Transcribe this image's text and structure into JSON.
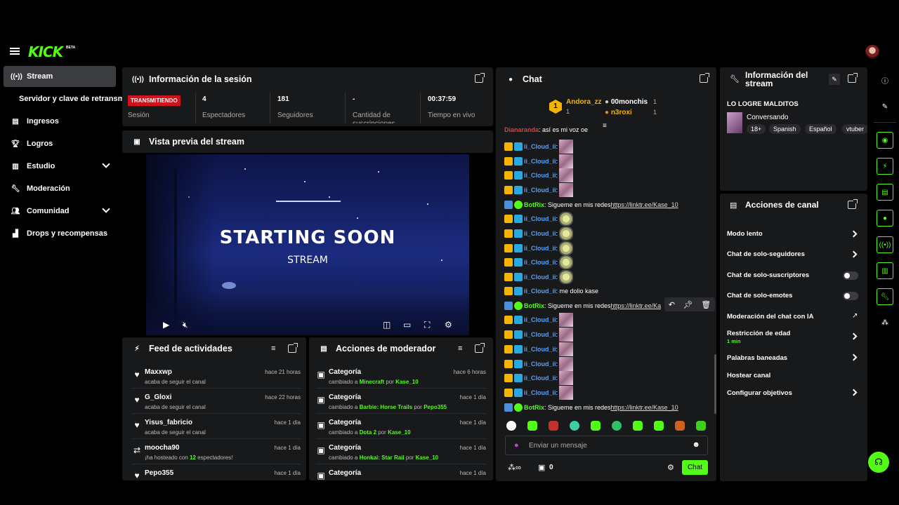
{
  "brand": {
    "logo": "KICK",
    "beta": "BETA"
  },
  "sidebar": {
    "items": [
      {
        "label": "Stream",
        "icon": "broadcast-icon"
      },
      {
        "label": "Servidor y clave de retransmisión",
        "icon": ""
      },
      {
        "label": "Ingresos",
        "icon": "chart-icon"
      },
      {
        "label": "Logros",
        "icon": "trophy-icon"
      },
      {
        "label": "Estudio",
        "icon": "layout-icon"
      },
      {
        "label": "Moderación",
        "icon": "wrench-icon"
      },
      {
        "label": "Comunidad",
        "icon": "users-icon"
      },
      {
        "label": "Drops y recompensas",
        "icon": "drops-icon"
      }
    ]
  },
  "session": {
    "title": "Información de la sesión",
    "status": "TRANSMITIENDO",
    "status_label": "Sesión",
    "stats": [
      {
        "value": "4",
        "label": "Espectadores"
      },
      {
        "value": "181",
        "label": "Seguidores"
      },
      {
        "value": "-",
        "label": "Cantidad de suscripciones"
      },
      {
        "value": "00:37:59",
        "label": "Tiempo en vivo"
      }
    ]
  },
  "preview": {
    "title": "Vista previa del stream",
    "headline": "STARTING SOON",
    "sub": "STREAM"
  },
  "feed": {
    "title": "Feed de actividades",
    "items": [
      {
        "name": "Maxxwp",
        "sub": "acaba de seguir el canal",
        "time": "hace 21 horas",
        "icon": "heart-icon"
      },
      {
        "name": "G_Gloxi",
        "sub": "acaba de seguir el canal",
        "time": "hace 22 horas",
        "icon": "heart-icon"
      },
      {
        "name": "Yisus_fabricio",
        "sub": "acaba de seguir el canal",
        "time": "hace 1 día",
        "icon": "heart-icon"
      },
      {
        "name": "moocha90",
        "sub_pre": "¡ha hosteado con ",
        "sub_num": "12",
        "sub_post": " espectadores!",
        "time": "hace 1 día",
        "icon": "host-icon"
      },
      {
        "name": "Pepo355",
        "sub": "",
        "time": "hace 1 día",
        "icon": "heart-icon"
      }
    ]
  },
  "modactions": {
    "title": "Acciones de moderador",
    "items": [
      {
        "name": "Categoría",
        "pre": "cambiado a ",
        "cat": "Minecraft",
        "by": " por ",
        "user": "Kase_10",
        "time": "hace 6 horas"
      },
      {
        "name": "Categoría",
        "pre": "cambiado a ",
        "cat": "Barbie: Horse Trails",
        "by": " por ",
        "user": "Pepo355",
        "time": "hace 1 día"
      },
      {
        "name": "Categoría",
        "pre": "cambiado a ",
        "cat": "Dota 2",
        "by": " por ",
        "user": "Kase_10",
        "time": "hace 1 día"
      },
      {
        "name": "Categoría",
        "pre": "cambiado a ",
        "cat": "Honkai: Star Rail",
        "by": " por ",
        "user": "Kase_10",
        "time": "hace 1 día"
      },
      {
        "name": "Categoría",
        "pre": "",
        "cat": "",
        "by": "",
        "user": "",
        "time": "hace 1 día"
      }
    ]
  },
  "chat": {
    "title": "Chat",
    "leaders": [
      {
        "rank": "1",
        "name": "Andora_zz",
        "count": "1"
      },
      {
        "name": "00monchis",
        "count": "1"
      },
      {
        "name": "n3roxi",
        "count": "1"
      }
    ],
    "partial": {
      "user": "Dianaranda",
      "text": ": así es mi voz oe"
    },
    "cloud_user": "ii_Cloud_ii",
    "bot_user": "BotRix",
    "bot_text": ": Sigueme en mis redes ",
    "bot_link": "https://linktr.ee/Kase_10",
    "bot_link_cut": "https://linktr.ee/Ka",
    "msg_text": ": me dolio kase",
    "input_placeholder": "Enviar un mensaje",
    "points": "0",
    "send_label": "Chat"
  },
  "streaminfo": {
    "title": "Información del stream",
    "stream_title": "LO LOGRE MALDITOS",
    "category": "Conversando",
    "tags": [
      "18+",
      "Spanish",
      "Español",
      "vtuber"
    ]
  },
  "channel_actions": {
    "title": "Acciones de canal",
    "items": [
      {
        "label": "Modo lento",
        "control": "chevron"
      },
      {
        "label": "Chat de solo-seguidores",
        "control": "chevron"
      },
      {
        "label": "Chat de solo-suscriptores",
        "control": "toggle",
        "on": false
      },
      {
        "label": "Chat de solo-emotes",
        "control": "toggle",
        "on": false
      },
      {
        "label": "Moderación del chat con IA",
        "control": "external"
      },
      {
        "label": "Restricción de edad",
        "sub": "1 min",
        "control": "chevron"
      },
      {
        "label": "Palabras baneadas",
        "control": "chevron"
      },
      {
        "label": "Hostear canal",
        "control": "none"
      },
      {
        "label": "Configurar objetivos",
        "control": "chevron"
      }
    ]
  },
  "colors": {
    "accent": "#53fc18",
    "live": "#d0121c",
    "panel": "#18191b",
    "bg": "#000000"
  }
}
